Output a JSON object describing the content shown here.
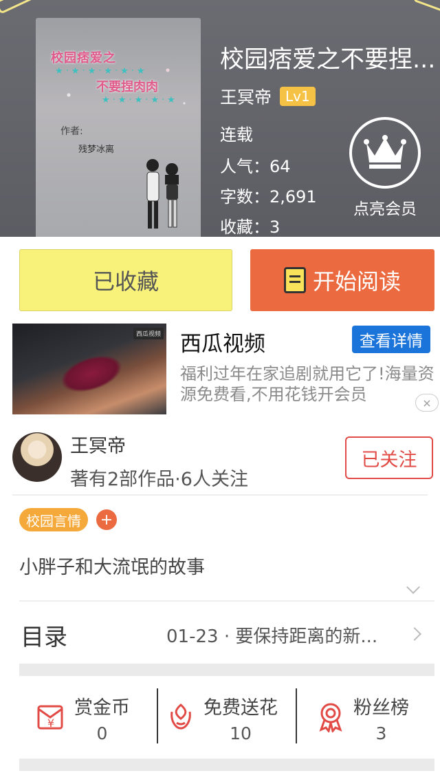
{
  "book": {
    "title": "校园痞爱之不要捏...",
    "author": "王冥帝",
    "level": "Lv1",
    "status": "连载",
    "popularity": "人气：64",
    "word_count": "字数：2,691",
    "favorites": "收藏：3",
    "vip_label": "点亮会员",
    "cover": {
      "title_line1": "校园痞爱之",
      "title_line2": "不要捏肉肉",
      "author_label": "作者:",
      "author_name": "残梦冰离"
    }
  },
  "actions": {
    "favorited_label": "已收藏",
    "read_label": "开始阅读"
  },
  "ad": {
    "title": "西瓜视频",
    "button": "查看详情",
    "description": "福利过年在家追剧就用它了!海量资源免费看,不用花钱开会员",
    "thumb_tag": "西瓜视频",
    "close": "×"
  },
  "author_card": {
    "name": "王冥帝",
    "info": "著有2部作品·6人关注",
    "follow_label": "已关注"
  },
  "tag": {
    "label": "校园言情",
    "add": "+"
  },
  "synopsis": "小胖子和大流氓的故事",
  "toc": {
    "label": "目录",
    "latest": "01-23 · 要保持距离的新..."
  },
  "stats": [
    {
      "label": "赏金币",
      "value": "0",
      "icon": "coin-envelope-icon"
    },
    {
      "label": "免费送花",
      "value": "10",
      "icon": "flower-icon"
    },
    {
      "label": "粉丝榜",
      "value": "3",
      "icon": "medal-icon"
    }
  ],
  "colors": {
    "accent_orange": "#ec6a40",
    "fav_yellow": "#f8f27a",
    "follow_red": "#e24b45",
    "ad_blue": "#1a74d9",
    "level_gold": "#f5c245",
    "tag_orange": "#f5a93a"
  }
}
